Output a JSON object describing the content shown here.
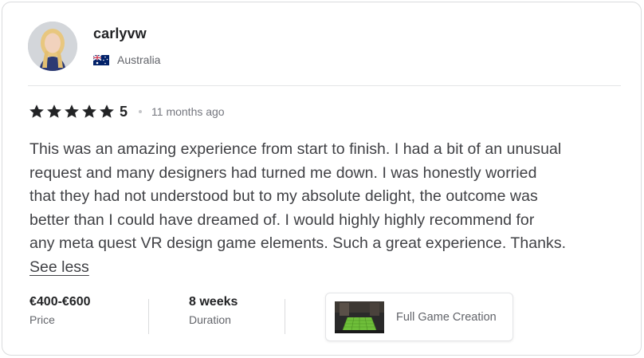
{
  "review": {
    "username": "carlyvw",
    "country": "Australia",
    "country_flag_icon": "australia-flag-icon",
    "rating_stars": 5,
    "rating_value": "5",
    "time_ago": "11 months ago",
    "text_lines": [
      "This was an amazing experience from start to finish. I had a bit of an unusual",
      "request and many designers had turned me down. I was honestly worried",
      "that they had not understood but to my absolute delight, the outcome was",
      "better than I could have dreamed of. I would highly highly recommend for",
      "any meta quest VR design game elements. Such a great experience. Thanks."
    ],
    "see_less_label": "See less",
    "price": {
      "value": "€400-€600",
      "label": "Price"
    },
    "duration": {
      "value": "8 weeks",
      "label": "Duration"
    },
    "gig": {
      "title": "Full Game Creation"
    }
  },
  "colors": {
    "star": "#222325",
    "text": "#404145",
    "muted": "#62646a",
    "border": "#dadbdd"
  }
}
